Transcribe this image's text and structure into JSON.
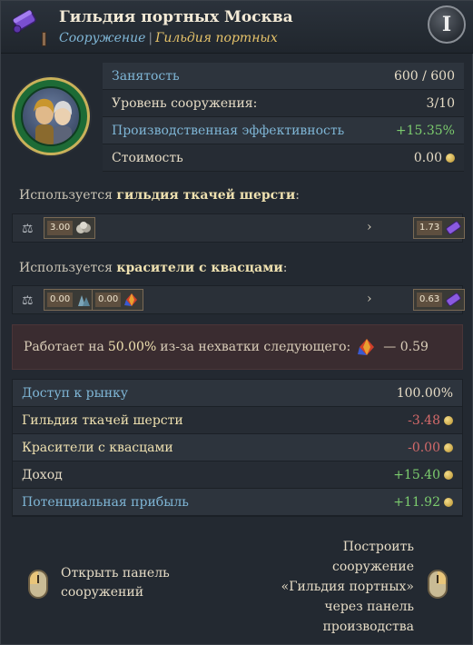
{
  "header": {
    "title": "Гильдия портных Москва",
    "breadcrumb_link": "Сооружение",
    "breadcrumb_sep": "|",
    "breadcrumb_current": "Гильдия портных",
    "info_button": "I"
  },
  "stats": [
    {
      "label": "Занятость",
      "value": "600 / 600"
    },
    {
      "label": "Уровень сооружения:",
      "value": "3/10"
    },
    {
      "label": "Производственная эффективность",
      "value": "+15.35%"
    },
    {
      "label": "Стоимость",
      "value": "0.00"
    }
  ],
  "inputs": [
    {
      "prefix": "Используется",
      "good": "гильдия ткачей шерсти",
      "suffix": ":",
      "inputs": [
        {
          "amount": "3.00",
          "icon": "wool-icon"
        }
      ],
      "output": {
        "amount": "1.73",
        "icon": "cloth-icon"
      }
    },
    {
      "prefix": "Используется",
      "good": "красители с квасцами",
      "suffix": ":",
      "inputs": [
        {
          "amount": "0.00",
          "icon": "alum-icon"
        },
        {
          "amount": "0.00",
          "icon": "dye-icon"
        }
      ],
      "output": {
        "amount": "0.63",
        "icon": "cloth-icon"
      }
    }
  ],
  "warning": {
    "prefix": "Работает на",
    "percent": "50.00%",
    "suffix": "из-за нехватки следующего:",
    "value": "— 0.59"
  },
  "market": [
    {
      "label": "Доступ к рынку",
      "value": "100.00%"
    },
    {
      "label": "Гильдия ткачей шерсти",
      "value": "-3.48"
    },
    {
      "label": "Красители с квасцами",
      "value": "-0.00"
    },
    {
      "label": "Доход",
      "value": "+15.40"
    },
    {
      "label": "Потенциальная прибыль",
      "value": "+11.92"
    }
  ],
  "footer": {
    "left_line1": "Открыть панель",
    "left_line2": "сооружений",
    "right_line1": "Построить",
    "right_line2": "сооружение",
    "right_line3": "«Гильдия портных»",
    "right_line4": "через панель",
    "right_line5": "производства"
  },
  "colors": {
    "label_blue": "#7fb6d6",
    "positive": "#7ccc6e",
    "negative": "#d46a6a",
    "highlight": "#efe1b0"
  }
}
